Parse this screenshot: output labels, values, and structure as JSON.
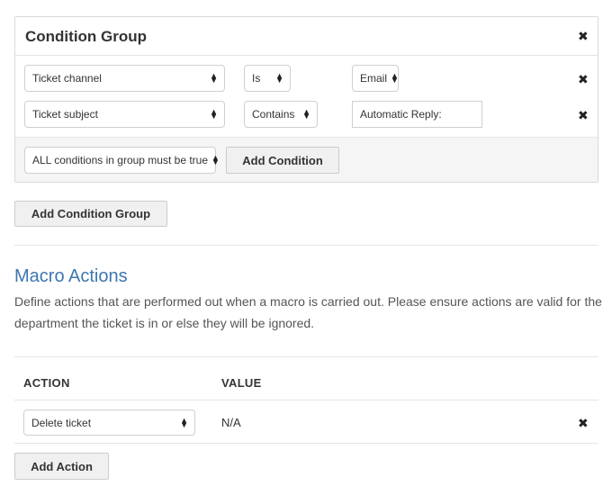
{
  "condition_group": {
    "title": "Condition Group",
    "conditions": [
      {
        "field": "Ticket channel",
        "operator": "Is",
        "value": "Email"
      },
      {
        "field": "Ticket subject",
        "operator": "Contains",
        "value": "Automatic Reply:"
      }
    ],
    "match_mode": "ALL conditions in group must be true",
    "add_condition_label": "Add Condition"
  },
  "add_condition_group_label": "Add Condition Group",
  "macro_actions": {
    "heading": "Macro Actions",
    "description": "Define actions that are performed out when a macro is carried out. Please ensure actions are valid for the department the ticket is in or else they will be ignored.",
    "columns": {
      "action": "ACTION",
      "value": "VALUE"
    },
    "rows": [
      {
        "action": "Delete ticket",
        "value": "N/A"
      }
    ],
    "add_action_label": "Add Action"
  },
  "icons": {
    "remove": "×",
    "close": "×"
  }
}
